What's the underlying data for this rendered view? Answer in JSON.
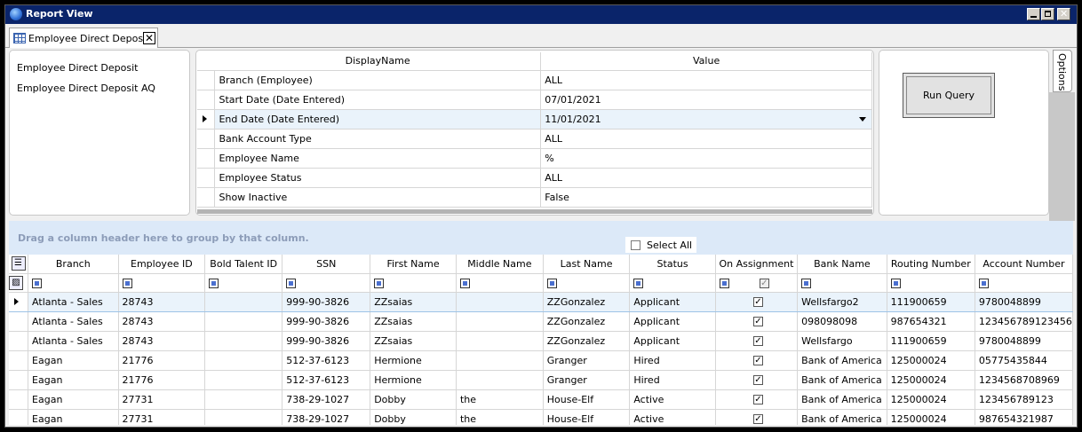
{
  "window": {
    "title": "Report View"
  },
  "tab": {
    "label": "Employee Direct Deposit"
  },
  "reports": [
    "Employee Direct Deposit",
    "Employee Direct Deposit AQ"
  ],
  "params": {
    "headers": {
      "name": "DisplayName",
      "value": "Value"
    },
    "rows": [
      {
        "name": "Branch (Employee)",
        "value": "ALL"
      },
      {
        "name": "Start Date (Date Entered)",
        "value": "07/01/2021"
      },
      {
        "name": "End Date (Date Entered)",
        "value": "11/01/2021"
      },
      {
        "name": "Bank Account Type",
        "value": "ALL"
      },
      {
        "name": "Employee Name",
        "value": "%"
      },
      {
        "name": "Employee Status",
        "value": "ALL"
      },
      {
        "name": "Show Inactive",
        "value": "False"
      }
    ]
  },
  "run_query_label": "Run Query",
  "options_label": "Options",
  "group_hint": "Drag a column header here to group by that column.",
  "select_all_label": "Select All",
  "grid": {
    "columns": [
      "Branch",
      "Employee ID",
      "Bold Talent ID",
      "SSN",
      "First Name",
      "Middle Name",
      "Last Name",
      "Status",
      "On Assignment",
      "Bank Name",
      "Routing Number",
      "Account Number"
    ],
    "rows": [
      {
        "branch": "Atlanta - Sales",
        "employee_id": "28743",
        "bold_talent_id": "",
        "ssn": "999-90-3826",
        "first_name": "ZZsaias",
        "middle_name": "",
        "last_name": "ZZGonzalez",
        "status": "Applicant",
        "on_assignment": true,
        "bank_name": "Wellsfargo2",
        "routing_number": "111900659",
        "account_number": "9780048899"
      },
      {
        "branch": "Atlanta - Sales",
        "employee_id": "28743",
        "bold_talent_id": "",
        "ssn": "999-90-3826",
        "first_name": "ZZsaias",
        "middle_name": "",
        "last_name": "ZZGonzalez",
        "status": "Applicant",
        "on_assignment": true,
        "bank_name": "098098098",
        "routing_number": "987654321",
        "account_number": "123456789123456"
      },
      {
        "branch": "Atlanta - Sales",
        "employee_id": "28743",
        "bold_talent_id": "",
        "ssn": "999-90-3826",
        "first_name": "ZZsaias",
        "middle_name": "",
        "last_name": "ZZGonzalez",
        "status": "Applicant",
        "on_assignment": true,
        "bank_name": "Wellsfargo",
        "routing_number": "111900659",
        "account_number": "9780048899"
      },
      {
        "branch": "Eagan",
        "employee_id": "21776",
        "bold_talent_id": "",
        "ssn": "512-37-6123",
        "first_name": "Hermione",
        "middle_name": "",
        "last_name": "Granger",
        "status": "Hired",
        "on_assignment": true,
        "bank_name": "Bank of America",
        "routing_number": "125000024",
        "account_number": "05775435844"
      },
      {
        "branch": "Eagan",
        "employee_id": "21776",
        "bold_talent_id": "",
        "ssn": "512-37-6123",
        "first_name": "Hermione",
        "middle_name": "",
        "last_name": "Granger",
        "status": "Hired",
        "on_assignment": true,
        "bank_name": "Bank of America",
        "routing_number": "125000024",
        "account_number": "1234568708969"
      },
      {
        "branch": "Eagan",
        "employee_id": "27731",
        "bold_talent_id": "",
        "ssn": "738-29-1027",
        "first_name": "Dobby",
        "middle_name": "the",
        "last_name": "House-Elf",
        "status": "Active",
        "on_assignment": true,
        "bank_name": "Bank of America",
        "routing_number": "125000024",
        "account_number": "123456789123"
      },
      {
        "branch": "Eagan",
        "employee_id": "27731",
        "bold_talent_id": "",
        "ssn": "738-29-1027",
        "first_name": "Dobby",
        "middle_name": "the",
        "last_name": "House-Elf",
        "status": "Active",
        "on_assignment": true,
        "bank_name": "Bank of America",
        "routing_number": "125000024",
        "account_number": "987654321987"
      }
    ]
  }
}
